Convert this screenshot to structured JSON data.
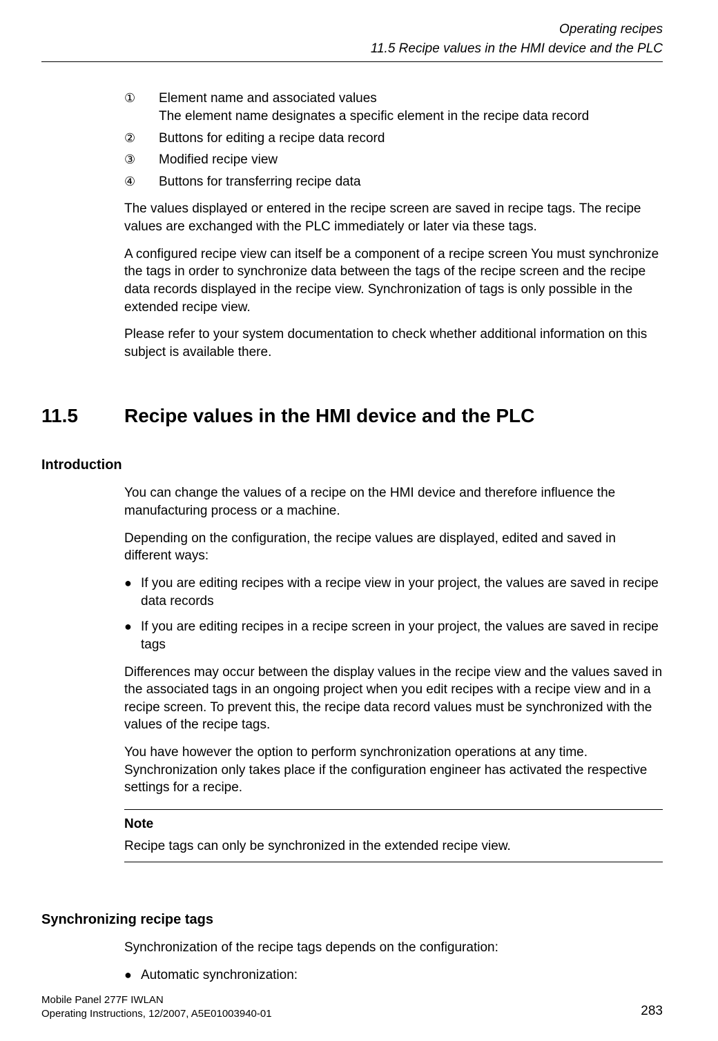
{
  "header": {
    "chapter": "Operating recipes",
    "section": "11.5 Recipe values in the HMI device and the PLC"
  },
  "legend": {
    "items": [
      {
        "num": "①",
        "line1": "Element name and associated values",
        "line2": "The element name designates a specific element in the recipe data record"
      },
      {
        "num": "②",
        "line1": "Buttons for editing a recipe data record",
        "line2": ""
      },
      {
        "num": "③",
        "line1": "Modified recipe view",
        "line2": ""
      },
      {
        "num": "④",
        "line1": "Buttons for transferring recipe data",
        "line2": ""
      }
    ]
  },
  "intro_paras": {
    "p1": "The values displayed or entered in the recipe screen are saved in recipe tags. The recipe values are exchanged with the PLC immediately or later via these tags.",
    "p2": "A configured recipe view can itself be a component of a recipe screen You must synchronize the tags in order to synchronize data between the tags of the recipe screen and the recipe data records displayed in the recipe view. Synchronization of tags is only possible in the extended recipe view.",
    "p3": "Please refer to your system documentation to check whether additional information on this subject is available there."
  },
  "section": {
    "number": "11.5",
    "title": "Recipe values in the HMI device and the PLC"
  },
  "introduction": {
    "heading": "Introduction",
    "p1": "You can change the values of a recipe on the HMI device and therefore influence the manufacturing process or a machine.",
    "p2": "Depending on the configuration, the recipe values are displayed, edited and saved in different ways:",
    "bullets": [
      "If you are editing recipes with a recipe view in your project, the values are saved in recipe data records",
      "If you are editing recipes in a recipe screen in your project, the values are saved in recipe tags"
    ],
    "p3": "Differences may occur between the display values in the recipe view and the values saved in the associated tags in an ongoing project when you edit recipes with a recipe view and in a recipe screen. To prevent this, the recipe data record values must be synchronized with the values of the recipe tags.",
    "p4": "You have however the option to perform synchronization operations at any time. Synchronization only takes place if the configuration engineer has activated the respective settings for a recipe."
  },
  "note": {
    "label": "Note",
    "text": "Recipe tags can only be synchronized in the extended recipe view."
  },
  "sync": {
    "heading": "Synchronizing recipe tags",
    "p1": "Synchronization of the recipe tags depends on the configuration:",
    "bullets": [
      "Automatic synchronization:"
    ]
  },
  "footer": {
    "line1": "Mobile Panel 277F IWLAN",
    "line2": "Operating Instructions, 12/2007, A5E01003940-01",
    "page": "283"
  }
}
